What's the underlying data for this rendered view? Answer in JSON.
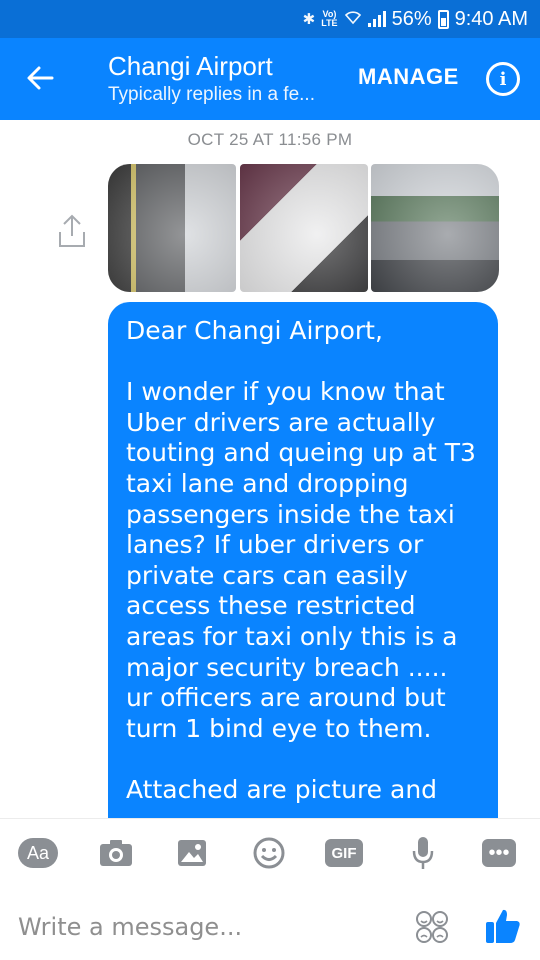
{
  "status_bar": {
    "volte_top": "Vo)",
    "volte_bottom": "LTE",
    "battery": "56%",
    "time": "9:40 AM"
  },
  "header": {
    "title": "Changi Airport",
    "subtitle": "Typically replies in a fe...",
    "manage_label": "MANAGE",
    "info_glyph": "i"
  },
  "conversation": {
    "timestamp": "OCT 25 AT 11:56 PM",
    "message": "Dear Changi Airport,\n\nI wonder if you know that Uber drivers are actually touting and queing up at T3 taxi lane and dropping passengers inside the taxi lanes? If uber drivers or private cars can easily access these restricted areas for taxi only this is a major security breach ..... ur officers are around but turn 1 bind eye to them.\n\nAttached are picture and"
  },
  "composer": {
    "aa_label": "Aa",
    "gif_label": "GIF",
    "more_label": "•••",
    "placeholder": "Write a message..."
  },
  "colors": {
    "status_bar": "#0a6fd6",
    "app_bar": "#0a84ff",
    "bubble": "#0a84ff",
    "icon_grey": "#8b8f94",
    "like_blue": "#0a84ff"
  }
}
